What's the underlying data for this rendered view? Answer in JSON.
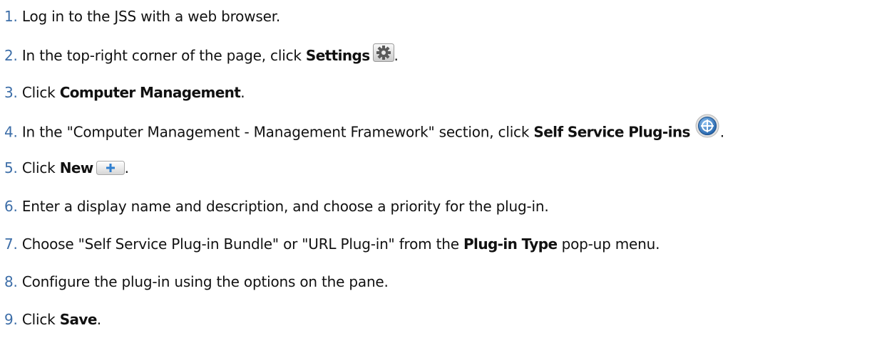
{
  "steps": [
    {
      "num": "1.",
      "text": "Log in to the JSS with a web browser."
    },
    {
      "num": "2.",
      "pre": "In the top-right corner of the page, click ",
      "bold": "Settings",
      "icon": "gear-icon",
      "post": "."
    },
    {
      "num": "3.",
      "pre": "Click ",
      "bold": "Computer Management",
      "post": "."
    },
    {
      "num": "4.",
      "pre": "In the \"Computer Management - Management Framework\" section, click ",
      "bold": "Self Service Plug-ins",
      "icon": "self-service-globe-icon",
      "post": "."
    },
    {
      "num": "5.",
      "pre": "Click ",
      "bold": "New",
      "icon": "plus-icon",
      "post": "."
    },
    {
      "num": "6.",
      "text": "Enter a display name and description, and choose a priority for the plug-in."
    },
    {
      "num": "7.",
      "pre": "Choose \"Self Service Plug-in Bundle\" or \"URL Plug-in\" from the ",
      "bold": "Plug-in Type",
      "post": " pop-up menu."
    },
    {
      "num": "8.",
      "text": "Configure the plug-in using the options on the pane."
    },
    {
      "num": "9.",
      "pre": "Click ",
      "bold": "Save",
      "post": "."
    }
  ],
  "colors": {
    "step_number": "#3d6ea8",
    "text": "#111111",
    "button_blue": "#2f7fd0"
  }
}
